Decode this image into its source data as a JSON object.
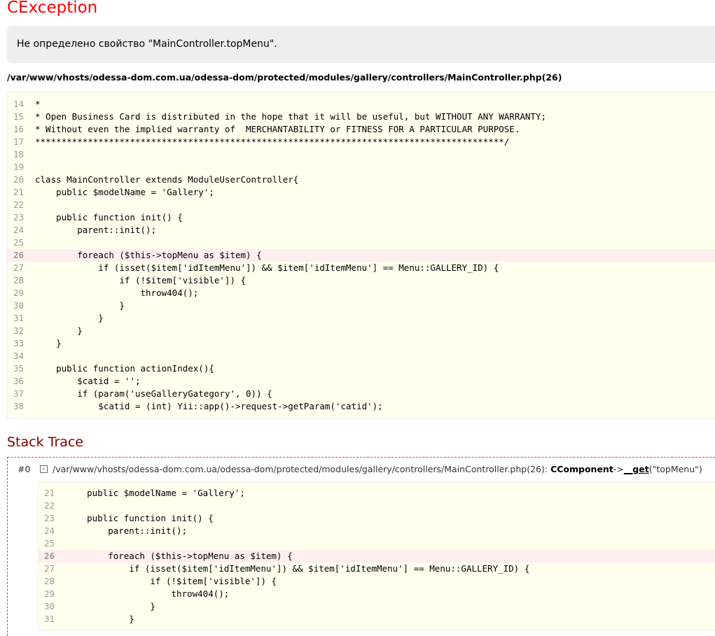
{
  "exception": {
    "title": "CException",
    "message": "Не определено свойство \"MainController.topMenu\".",
    "source_path": "/var/www/vhosts/odessa-dom.com.ua/odessa-dom/protected/modules/gallery/controllers/MainController.php(26)"
  },
  "source": {
    "highlight_line": "26",
    "lines": [
      {
        "n": "14",
        "code": "*"
      },
      {
        "n": "15",
        "code": "* Open Business Card is distributed in the hope that it will be useful, but WITHOUT ANY WARRANTY;"
      },
      {
        "n": "16",
        "code": "* Without even the implied warranty of  MERCHANTABILITY or FITNESS FOR A PARTICULAR PURPOSE."
      },
      {
        "n": "17",
        "code": "*****************************************************************************************/"
      },
      {
        "n": "18",
        "code": ""
      },
      {
        "n": "19",
        "code": ""
      },
      {
        "n": "20",
        "code": "class MainController extends ModuleUserController{"
      },
      {
        "n": "21",
        "code": "    public $modelName = 'Gallery';"
      },
      {
        "n": "22",
        "code": ""
      },
      {
        "n": "23",
        "code": "    public function init() {"
      },
      {
        "n": "24",
        "code": "        parent::init();"
      },
      {
        "n": "25",
        "code": ""
      },
      {
        "n": "26",
        "code": "        foreach ($this->topMenu as $item) {"
      },
      {
        "n": "27",
        "code": "            if (isset($item['idItemMenu']) && $item['idItemMenu'] == Menu::GALLERY_ID) {"
      },
      {
        "n": "28",
        "code": "                if (!$item['visible']) {"
      },
      {
        "n": "29",
        "code": "                    throw404();"
      },
      {
        "n": "30",
        "code": "                }"
      },
      {
        "n": "31",
        "code": "            }"
      },
      {
        "n": "32",
        "code": "        }"
      },
      {
        "n": "33",
        "code": "    }"
      },
      {
        "n": "34",
        "code": ""
      },
      {
        "n": "35",
        "code": "    public function actionIndex(){"
      },
      {
        "n": "36",
        "code": "        $catid = '';"
      },
      {
        "n": "37",
        "code": "        if (param('useGalleryGategory', 0)) {"
      },
      {
        "n": "38",
        "code": "            $catid = (int) Yii::app()->request->getParam('catid');"
      }
    ]
  },
  "stack_trace": {
    "title": "Stack Trace",
    "items": [
      {
        "index": "#0",
        "toggle": "-",
        "file": "/var/www/vhosts/odessa-dom.com.ua/odessa-dom/protected/modules/gallery/controllers/MainController.php(26): ",
        "class": "CComponent",
        "arrow": "->",
        "method": "__get",
        "args": "(\"topMenu\")",
        "highlight_line": "26",
        "lines": [
          {
            "n": "21",
            "code": "    public $modelName = 'Gallery';"
          },
          {
            "n": "22",
            "code": ""
          },
          {
            "n": "23",
            "code": "    public function init() {"
          },
          {
            "n": "24",
            "code": "        parent::init();"
          },
          {
            "n": "25",
            "code": ""
          },
          {
            "n": "26",
            "code": "        foreach ($this->topMenu as $item) {"
          },
          {
            "n": "27",
            "code": "            if (isset($item['idItemMenu']) && $item['idItemMenu'] == Menu::GALLERY_ID) {"
          },
          {
            "n": "28",
            "code": "                if (!$item['visible']) {"
          },
          {
            "n": "29",
            "code": "                    throw404();"
          },
          {
            "n": "30",
            "code": "                }"
          },
          {
            "n": "31",
            "code": "            }"
          }
        ]
      }
    ]
  },
  "colors": {
    "title": "#ff0000",
    "stack_title": "#800000",
    "code_bg": "#ffffee",
    "highlight_bg": "#ffeeee",
    "line_number": "#999999"
  }
}
